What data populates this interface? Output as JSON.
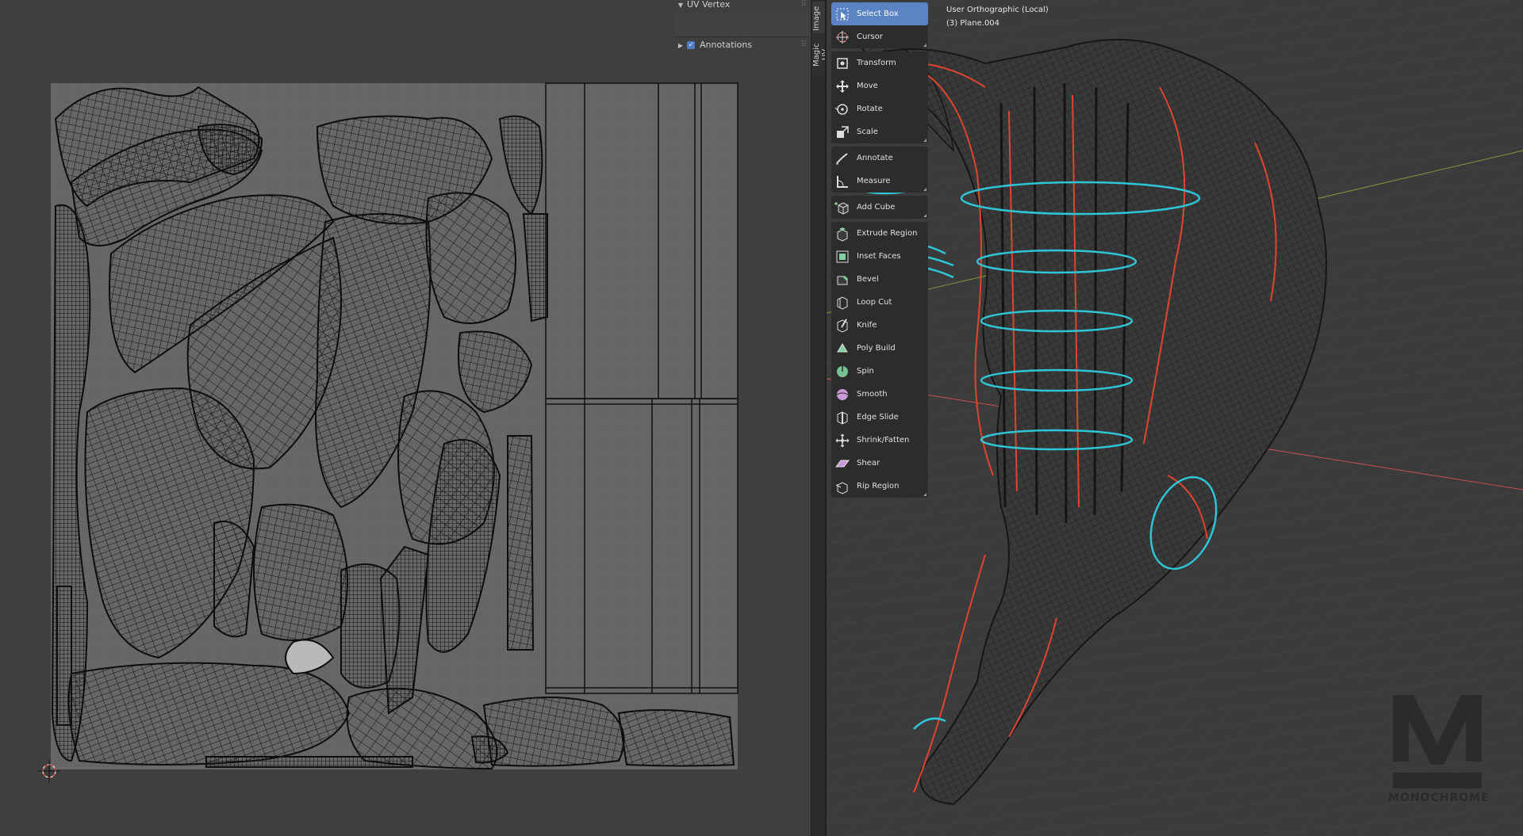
{
  "uv_editor": {
    "n_panel": {
      "uv_vertex_label": "UV Vertex",
      "annotations_label": "Annotations",
      "annotations_checked": true
    },
    "side_tabs": [
      "Image",
      "Magic UV"
    ],
    "cursor_icon": "2d-cursor-icon"
  },
  "viewport": {
    "view_name": "User Orthographic (Local)",
    "object_name": "(3) Plane.004",
    "axis_colors": {
      "x": "#c9504d",
      "y": "#7f9a3a"
    },
    "wire_colors": {
      "mesh": "#1a1a1a",
      "seams": "#e0442f",
      "selected": "#2ec6d6"
    }
  },
  "toolbar": {
    "active_color": "#5b84c4",
    "groups": [
      [
        {
          "label": "Select Box",
          "icon": "select-box-icon",
          "active": true
        },
        {
          "label": "Cursor",
          "icon": "cursor-icon"
        }
      ],
      [
        {
          "label": "Transform",
          "icon": "transform-icon"
        },
        {
          "label": "Move",
          "icon": "move-icon"
        },
        {
          "label": "Rotate",
          "icon": "rotate-icon"
        },
        {
          "label": "Scale",
          "icon": "scale-icon"
        }
      ],
      [
        {
          "label": "Annotate",
          "icon": "annotate-icon"
        },
        {
          "label": "Measure",
          "icon": "measure-icon"
        }
      ],
      [
        {
          "label": "Add Cube",
          "icon": "add-cube-icon"
        }
      ],
      [
        {
          "label": "Extrude Region",
          "icon": "extrude-region-icon"
        },
        {
          "label": "Inset Faces",
          "icon": "inset-faces-icon"
        },
        {
          "label": "Bevel",
          "icon": "bevel-icon"
        },
        {
          "label": "Loop Cut",
          "icon": "loop-cut-icon"
        },
        {
          "label": "Knife",
          "icon": "knife-icon"
        },
        {
          "label": "Poly Build",
          "icon": "poly-build-icon"
        },
        {
          "label": "Spin",
          "icon": "spin-icon"
        },
        {
          "label": "Smooth",
          "icon": "smooth-icon"
        },
        {
          "label": "Edge Slide",
          "icon": "edge-slide-icon"
        },
        {
          "label": "Shrink/Fatten",
          "icon": "shrink-fatten-icon"
        },
        {
          "label": "Shear",
          "icon": "shear-icon"
        },
        {
          "label": "Rip Region",
          "icon": "rip-region-icon"
        }
      ]
    ]
  },
  "watermark": {
    "letter": "M",
    "text": "MONOCHROME"
  }
}
